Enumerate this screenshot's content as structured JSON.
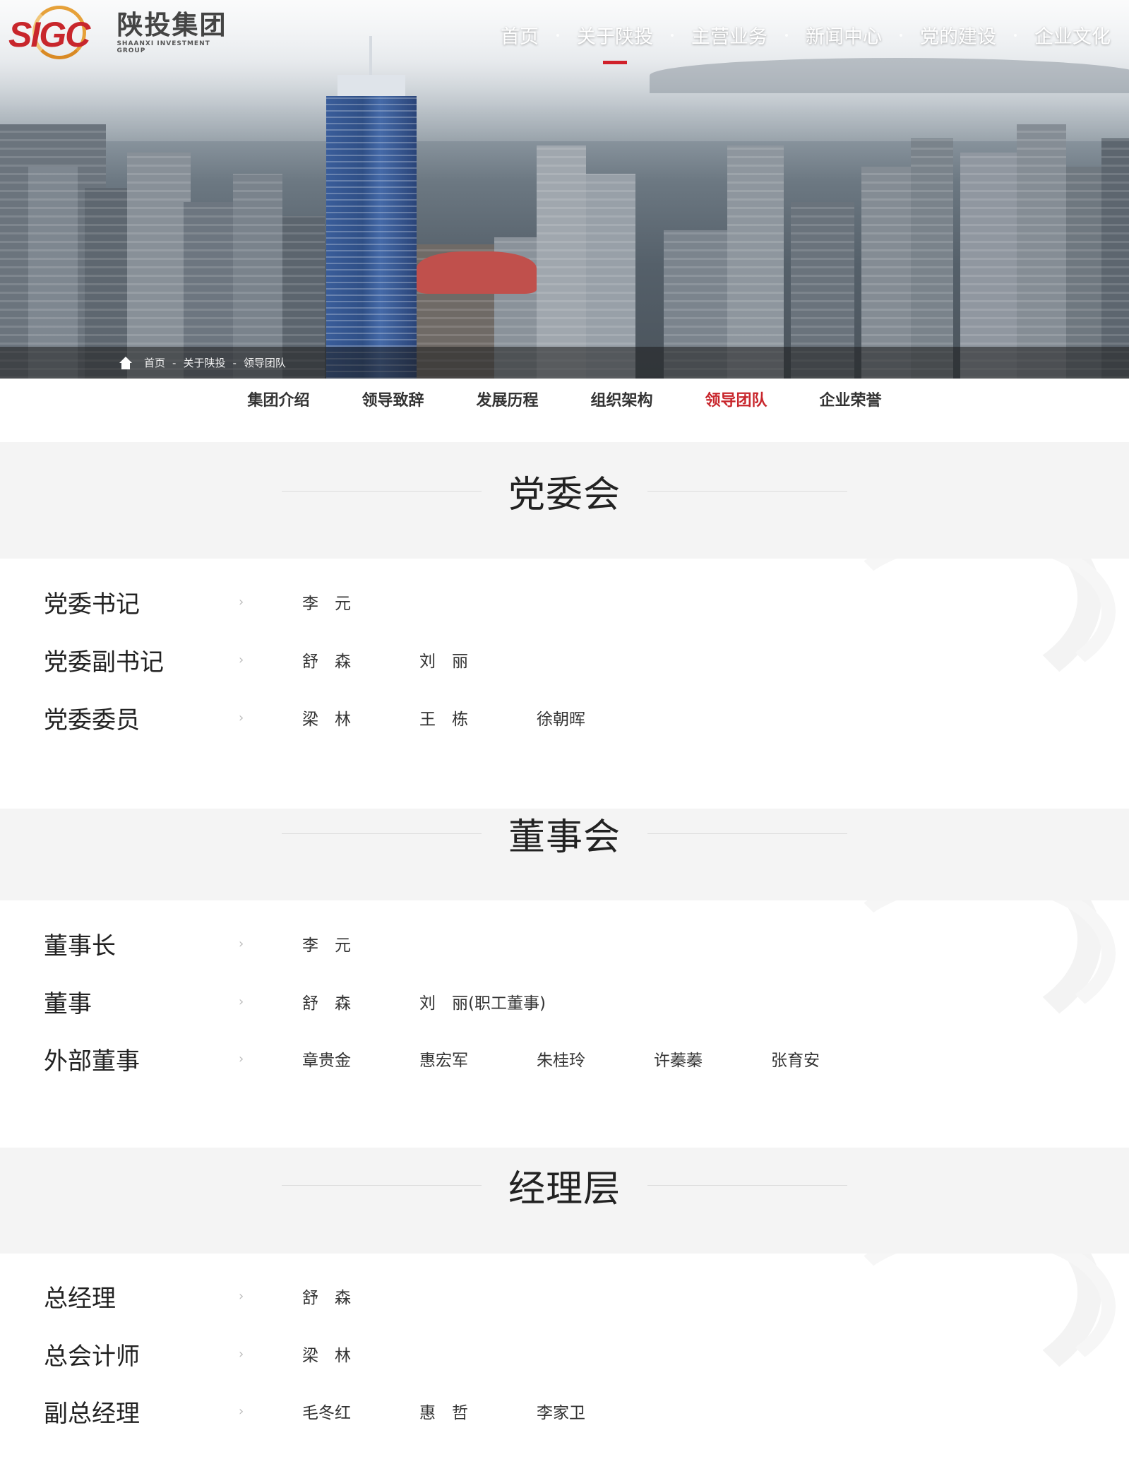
{
  "header": {
    "logo_mark": "SIGC",
    "logo_cn": "陕投集团",
    "logo_en": "SHAANXI INVESTMENT GROUP",
    "nav": [
      {
        "label": "首页",
        "active": false
      },
      {
        "label": "关于陕投",
        "active": true
      },
      {
        "label": "主营业务",
        "active": false
      },
      {
        "label": "新闻中心",
        "active": false
      },
      {
        "label": "党的建设",
        "active": false
      },
      {
        "label": "企业文化",
        "active": false
      }
    ],
    "accent_color": "#d0202a"
  },
  "breadcrumb": [
    "首页",
    "关于陕投",
    "领导团队"
  ],
  "subnav": [
    {
      "label": "集团介绍",
      "active": false
    },
    {
      "label": "领导致辞",
      "active": false
    },
    {
      "label": "发展历程",
      "active": false
    },
    {
      "label": "组织架构",
      "active": false
    },
    {
      "label": "领导团队",
      "active": true
    },
    {
      "label": "企业荣誉",
      "active": false
    }
  ],
  "sections": [
    {
      "title": "党委会",
      "roles": [
        {
          "role": "党委书记",
          "members": [
            "李　元"
          ]
        },
        {
          "role": "党委副书记",
          "members": [
            "舒　森",
            "刘　丽"
          ]
        },
        {
          "role": "党委委员",
          "members": [
            "梁　林",
            "王　栋",
            "徐朝晖"
          ]
        }
      ]
    },
    {
      "title": "董事会",
      "roles": [
        {
          "role": "董事长",
          "members": [
            "李　元"
          ]
        },
        {
          "role": "董事",
          "members": [
            "舒　森",
            "刘　丽(职工董事)"
          ]
        },
        {
          "role": "外部董事",
          "members": [
            "章贵金",
            "惠宏军",
            "朱桂玲",
            "许蓁蓁",
            "张育安"
          ]
        }
      ]
    },
    {
      "title": "经理层",
      "roles": [
        {
          "role": "总经理",
          "members": [
            "舒　森"
          ]
        },
        {
          "role": "总会计师",
          "members": [
            "梁　林"
          ]
        },
        {
          "role": "副总经理",
          "members": [
            "毛冬红",
            "惠　哲",
            "李家卫"
          ]
        }
      ]
    }
  ]
}
